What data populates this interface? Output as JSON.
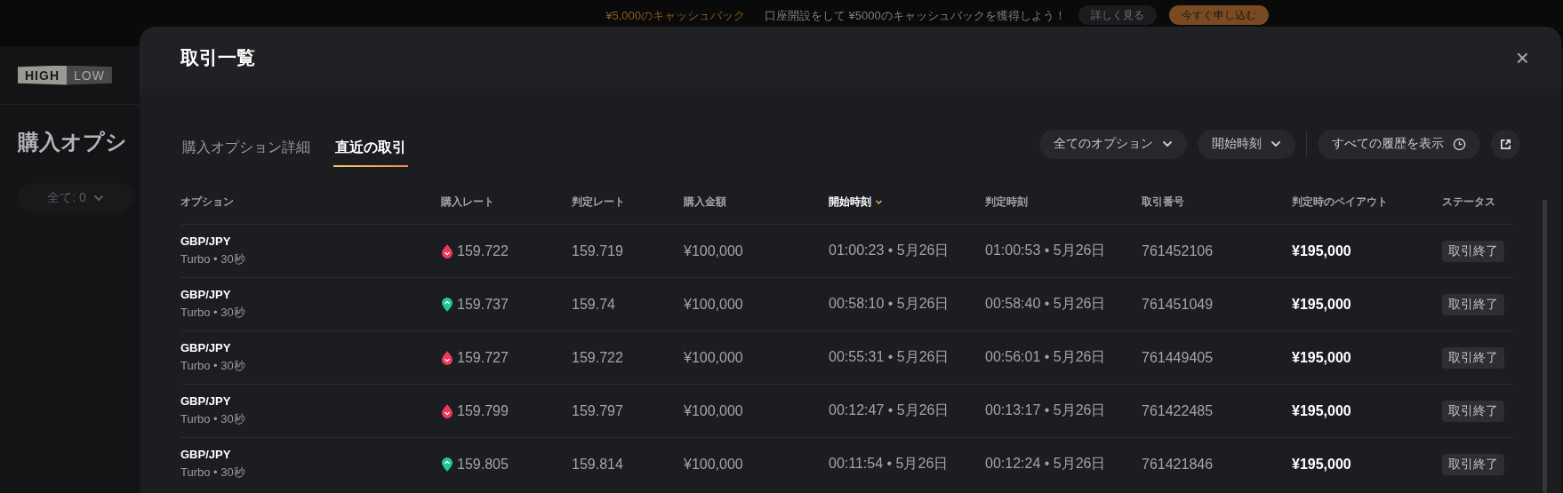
{
  "banner": {
    "headline": "¥5,000のキャッシュバック",
    "message": "口座開設をして ¥5000のキャッシュバックを獲得しよう！",
    "details_button": "詳しく見る",
    "apply_button": "今すぐ申し込む"
  },
  "background_page": {
    "logo": {
      "left": "HIGH",
      "right": "LOW"
    },
    "title": "購入オプシ",
    "filter": "全て: 0"
  },
  "modal": {
    "title": "取引一覧",
    "close": "×",
    "tabs": [
      {
        "label": "購入オプション詳細",
        "selected": false
      },
      {
        "label": "直近の取引",
        "selected": true
      }
    ],
    "filters": [
      {
        "label": "全てのオプション"
      },
      {
        "label": "開始時刻"
      }
    ],
    "history_button": "すべての履歴を表示",
    "columns": [
      {
        "label": "オプション",
        "sorted": false
      },
      {
        "label": "購入レート",
        "sorted": false
      },
      {
        "label": "判定レート",
        "sorted": false
      },
      {
        "label": "購入金額",
        "sorted": false
      },
      {
        "label": "開始時刻",
        "sorted": true
      },
      {
        "label": "判定時刻",
        "sorted": false
      },
      {
        "label": "取引番号",
        "sorted": false
      },
      {
        "label": "判定時のペイアウト",
        "sorted": false
      },
      {
        "label": "ステータス",
        "sorted": false
      }
    ],
    "rows": [
      {
        "asset": "GBP/JPY",
        "type": "Turbo • 30秒",
        "kind": "down",
        "purchase_rate": "159.722",
        "judged_rate": "159.719",
        "amount": "¥100,000",
        "start": "01:00:23 • 5月26日",
        "end": "01:00:53 • 5月26日",
        "trade_id": "761452106",
        "payout": "¥195,000",
        "status": "取引終了"
      },
      {
        "asset": "GBP/JPY",
        "type": "Turbo • 30秒",
        "kind": "up",
        "purchase_rate": "159.737",
        "judged_rate": "159.74",
        "amount": "¥100,000",
        "start": "00:58:10 • 5月26日",
        "end": "00:58:40 • 5月26日",
        "trade_id": "761451049",
        "payout": "¥195,000",
        "status": "取引終了"
      },
      {
        "asset": "GBP/JPY",
        "type": "Turbo • 30秒",
        "kind": "down",
        "purchase_rate": "159.727",
        "judged_rate": "159.722",
        "amount": "¥100,000",
        "start": "00:55:31 • 5月26日",
        "end": "00:56:01 • 5月26日",
        "trade_id": "761449405",
        "payout": "¥195,000",
        "status": "取引終了"
      },
      {
        "asset": "GBP/JPY",
        "type": "Turbo • 30秒",
        "kind": "down",
        "purchase_rate": "159.799",
        "judged_rate": "159.797",
        "amount": "¥100,000",
        "start": "00:12:47 • 5月26日",
        "end": "00:13:17 • 5月26日",
        "trade_id": "761422485",
        "payout": "¥195,000",
        "status": "取引終了"
      },
      {
        "asset": "GBP/JPY",
        "type": "Turbo • 30秒",
        "kind": "up",
        "purchase_rate": "159.805",
        "judged_rate": "159.814",
        "amount": "¥100,000",
        "start": "00:11:54 • 5月26日",
        "end": "00:12:24 • 5月26日",
        "trade_id": "761421846",
        "payout": "¥195,000",
        "status": "取引終了"
      }
    ]
  }
}
